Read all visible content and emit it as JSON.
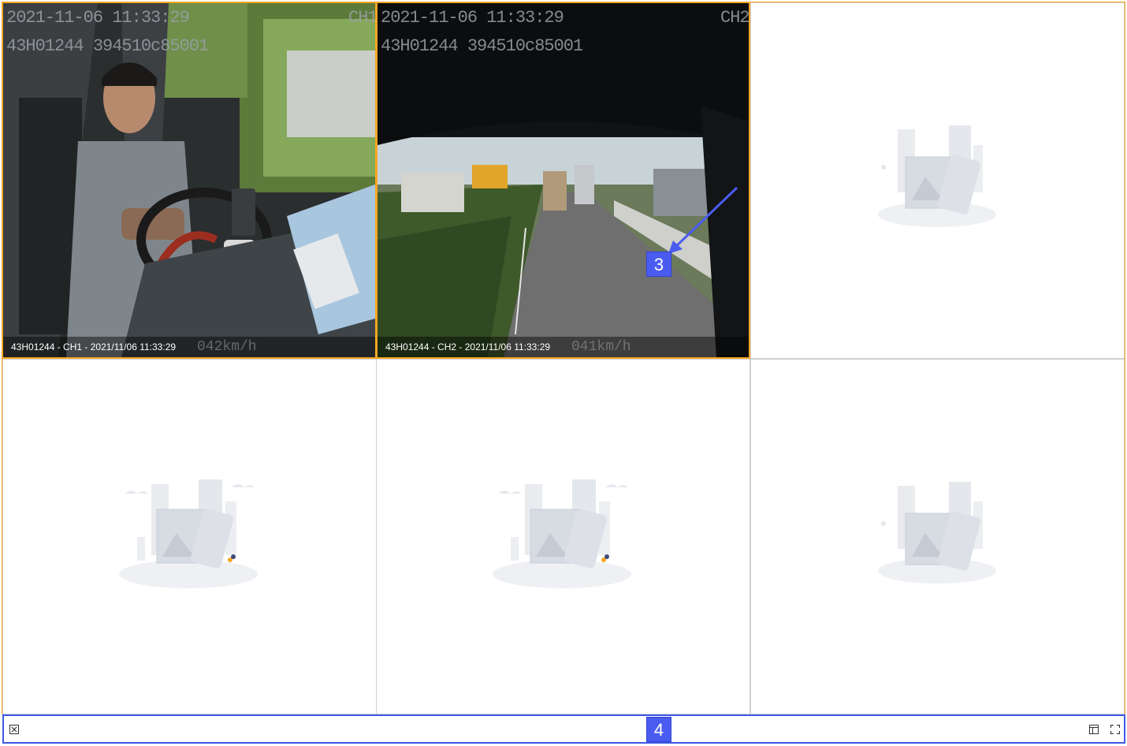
{
  "cells": [
    {
      "osd_date": "2021-11-06 11:33:29",
      "osd_channel": "CH1",
      "osd_plate": "43H01244 394510c85001",
      "caption": "43H01244 - CH1 - 2021/11/06 11:33:29",
      "speed_overlay": "042km/h"
    },
    {
      "osd_date": "2021-11-06 11:33:29",
      "osd_channel": "CH2",
      "osd_plate": "43H01244 394510c85001",
      "caption": "43H01244 - CH2 - 2021/11/06 11:33:29",
      "speed_overlay": "041km/h"
    }
  ],
  "annotations": {
    "marker_3": "3",
    "marker_4": "4"
  },
  "toolbar": {
    "close_icon": "close-box-icon",
    "layout_icon": "layout-icon",
    "fullscreen_icon": "fullscreen-icon"
  },
  "colors": {
    "active_border": "#f5a623",
    "annotation_blue": "#4a5cf0",
    "toolbar_border": "#3d5ae8"
  }
}
